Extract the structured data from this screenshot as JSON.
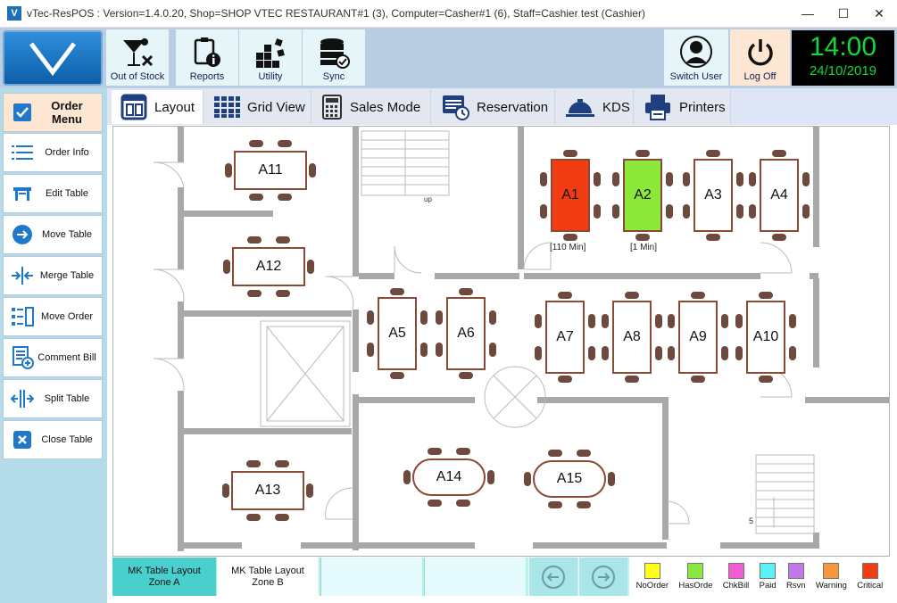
{
  "window": {
    "title": "vTec-ResPOS : Version=1.4.0.20, Shop=SHOP VTEC RESTAURANT#1 (3), Computer=Casher#1 (6), Staff=Cashier test  (Cashier)",
    "app_icon": "V"
  },
  "toolbar": {
    "out_of_stock": "Out of Stock",
    "reports": "Reports",
    "utility": "Utility",
    "sync": "Sync",
    "switch_user": "Switch User",
    "log_off": "Log Off"
  },
  "clock": {
    "time": "14:00",
    "date": "24/10/2019"
  },
  "sidebar": {
    "header": "Order Menu",
    "items": [
      {
        "label": "Order Info",
        "icon": "list-icon"
      },
      {
        "label": "Edit Table",
        "icon": "table-icon"
      },
      {
        "label": "Move Table",
        "icon": "arrow-right-icon"
      },
      {
        "label": "Merge Table",
        "icon": "merge-icon"
      },
      {
        "label": "Move Order",
        "icon": "move-order-icon"
      },
      {
        "label": "Comment Bill",
        "icon": "comment-icon"
      },
      {
        "label": "Split Table",
        "icon": "split-icon"
      },
      {
        "label": "Close Table",
        "icon": "close-icon"
      }
    ]
  },
  "tabs": [
    {
      "label": "Layout",
      "active": true
    },
    {
      "label": "Grid View"
    },
    {
      "label": "Sales Mode"
    },
    {
      "label": "Reservation"
    },
    {
      "label": "KDS"
    },
    {
      "label": "Printers"
    }
  ],
  "floor": {
    "stair_label": "up",
    "stair_label_2": "5",
    "tables": [
      {
        "name": "A11",
        "status": "empty"
      },
      {
        "name": "A12",
        "status": "empty"
      },
      {
        "name": "A1",
        "status": "critical",
        "note": "[110 Min]"
      },
      {
        "name": "A2",
        "status": "hasorder",
        "note": "[1 Min]"
      },
      {
        "name": "A3",
        "status": "empty"
      },
      {
        "name": "A4",
        "status": "empty"
      },
      {
        "name": "A5",
        "status": "empty"
      },
      {
        "name": "A6",
        "status": "empty"
      },
      {
        "name": "A7",
        "status": "empty"
      },
      {
        "name": "A8",
        "status": "empty"
      },
      {
        "name": "A9",
        "status": "empty"
      },
      {
        "name": "A10",
        "status": "empty"
      },
      {
        "name": "A13",
        "status": "empty"
      },
      {
        "name": "A14",
        "status": "empty"
      },
      {
        "name": "A15",
        "status": "empty"
      }
    ]
  },
  "zones": [
    {
      "line1": "MK Table Layout",
      "line2": "Zone A",
      "active": true
    },
    {
      "line1": "MK Table Layout",
      "line2": "Zone B"
    }
  ],
  "legend": [
    {
      "label": "NoOrder",
      "color": "#ffff1a"
    },
    {
      "label": "HasOrde",
      "color": "#8ce83a"
    },
    {
      "label": "ChkBill",
      "color": "#f25bd4"
    },
    {
      "label": "Paid",
      "color": "#5ef0f2"
    },
    {
      "label": "Rsvn",
      "color": "#c07ae8"
    },
    {
      "label": "Warning",
      "color": "#f59a3c"
    },
    {
      "label": "Critical",
      "color": "#f23c14"
    }
  ],
  "colors": {
    "critical": "#f23c14",
    "hasorder": "#8ce83a",
    "clock_text": "#12d838",
    "active_zone": "#4acfcf"
  }
}
